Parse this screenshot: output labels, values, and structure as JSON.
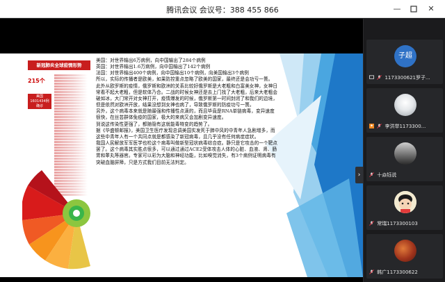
{
  "window": {
    "title": "腾讯会议 会议号：388 455 866",
    "minimize_icon": "minimize-icon",
    "maximize_icon": "maximize-icon",
    "close_icon": "close-icon"
  },
  "colors": {
    "titlebar_bg": "#ffffff",
    "stage_bg": "#000000",
    "sidebar_bg": "#1b1b1d",
    "accent_blue": "#2c87d8",
    "infographic_red": "#c81e1e"
  },
  "slide": {
    "infographic": {
      "header": "新冠肺炎全球疫情形势",
      "big_number": "215个",
      "box_line1": "美国",
      "box_line2": "1601434例",
      "box_line3": "确诊"
    },
    "paragraphs": [
      "美国：对世界输出6万病例，向中国输出了284个病例",
      "英国：对世界输出1.6万病例，向中国输出了142个病例",
      "法国：对世界输出400个病例，向中国输出10个病例，向美国输出3个病例",
      "所以，实际的传播者是欧美，如果防控重点忽略了欧美的国家，最终还是会功亏一篑。",
      "此外从欧罗斯的疫情，俄罗斯和欧洲的关系比较好俄罗斯是大老粗和白富美女神，女神日常看不起大老粗，但是软体乃合。二战的时候女神还是去上门找了大老粗，后来大老粗会破如冰，大门常开对女神打开，疫情爆发的时候，俄罗斯第一时间封闭了和我们的边境，但是依然对欧洲开放，结果没想到女神也病了，导致俄罗斯的防疫功亏一篑。",
      "另外，这个病毒本来就是随最强和传播性点滴的，而且毕竟是RNA单链病毒，变异速度很快，在丝芸群体免疫的国家，极大的来病又会加剧变异速度。",
      "到说这传染性更强了，都随隐有这就能毒特变的趋势了。",
      "据《华盛顿邮报》，美国卫生医疗发现总调美国实发死于肺中风的中青年人急剧增多，而这些中青年人有一个共同点就是都感染了新冠病毒，且几乎没有任何病症症状。",
      "我国人民解放军军医学也检这个病毒叫做新型冠状病毒综合症。静只是它攻击的一个靶点罢了。这个病毒其实胜点很多，可以通过通过ACE2受体攻击人体的心脏、血液、肾、肠胃和睾丸等器官。专家可以彩为大脑和神经功能，比如嗅觉消失，有3个病例证明病毒有突破血脑屏障，只是方式我们目前无法判定。"
    ]
  },
  "sidebar": {
    "expand_arrow": "›",
    "participants": [
      {
        "name": "1173300621罗子...",
        "avatar_text": "子超",
        "avatar_color": "#2f72c6"
      },
      {
        "name": "李洪举1173300...",
        "avatar_text": "",
        "avatar_color": "#9aa1a7"
      },
      {
        "name": "十焱钰说",
        "avatar_text": "",
        "avatar_color": "#777777"
      },
      {
        "name": "常瑞1173300103",
        "avatar_text": "",
        "avatar_color": "#e9e3c8"
      },
      {
        "name": "韩广1173300622",
        "avatar_text": "",
        "avatar_color": "#a0341c"
      }
    ]
  }
}
